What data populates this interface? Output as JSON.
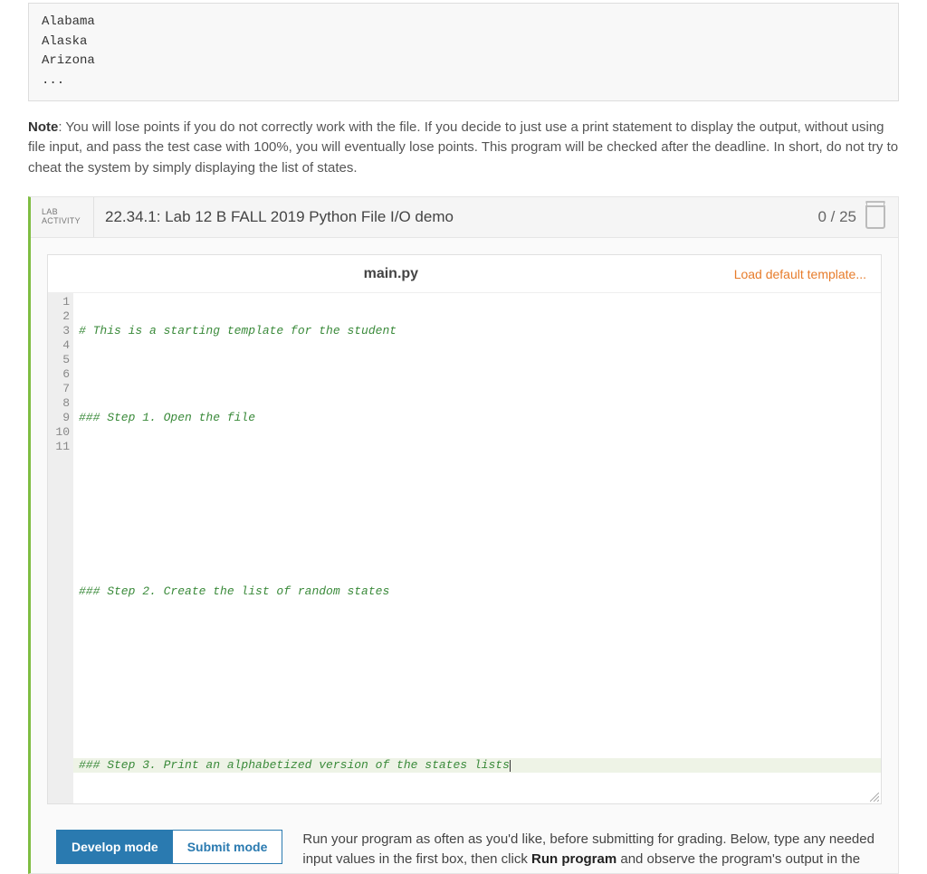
{
  "example": {
    "lines": [
      "Alabama",
      "Alaska",
      "Arizona",
      "..."
    ]
  },
  "note": {
    "label": "Note",
    "text": ": You will lose points if you do not correctly work with the file. If you decide to just use a print statement to display the output, without using file input, and pass the test case with 100%, you will eventually lose points. This program will be checked after the deadline. In short, do not try to cheat the system by simply displaying the list of states."
  },
  "lab": {
    "badge_line1": "LAB",
    "badge_line2": "ACTIVITY",
    "title": "22.34.1: Lab 12 B FALL 2019 Python File I/O demo",
    "score": "0 / 25"
  },
  "editor": {
    "filename": "main.py",
    "load_link": "Load default template...",
    "lines": [
      "# This is a starting template for the student",
      "",
      "### Step 1. Open the file",
      "",
      "",
      "",
      "### Step 2. Create the list of random states",
      "",
      "",
      "",
      "### Step 3. Print an alphabetized version of the states lists"
    ],
    "line_numbers": [
      "1",
      "2",
      "3",
      "4",
      "5",
      "6",
      "7",
      "8",
      "9",
      "10",
      "11"
    ],
    "active_line": 10
  },
  "modes": {
    "develop": "Develop mode",
    "submit": "Submit mode",
    "desc_before": "Run your program as often as you'd like, before submitting for grading. Below, type any needed input values in the first box, then click ",
    "desc_bold": "Run program",
    "desc_after": " and observe the program's output in the"
  }
}
